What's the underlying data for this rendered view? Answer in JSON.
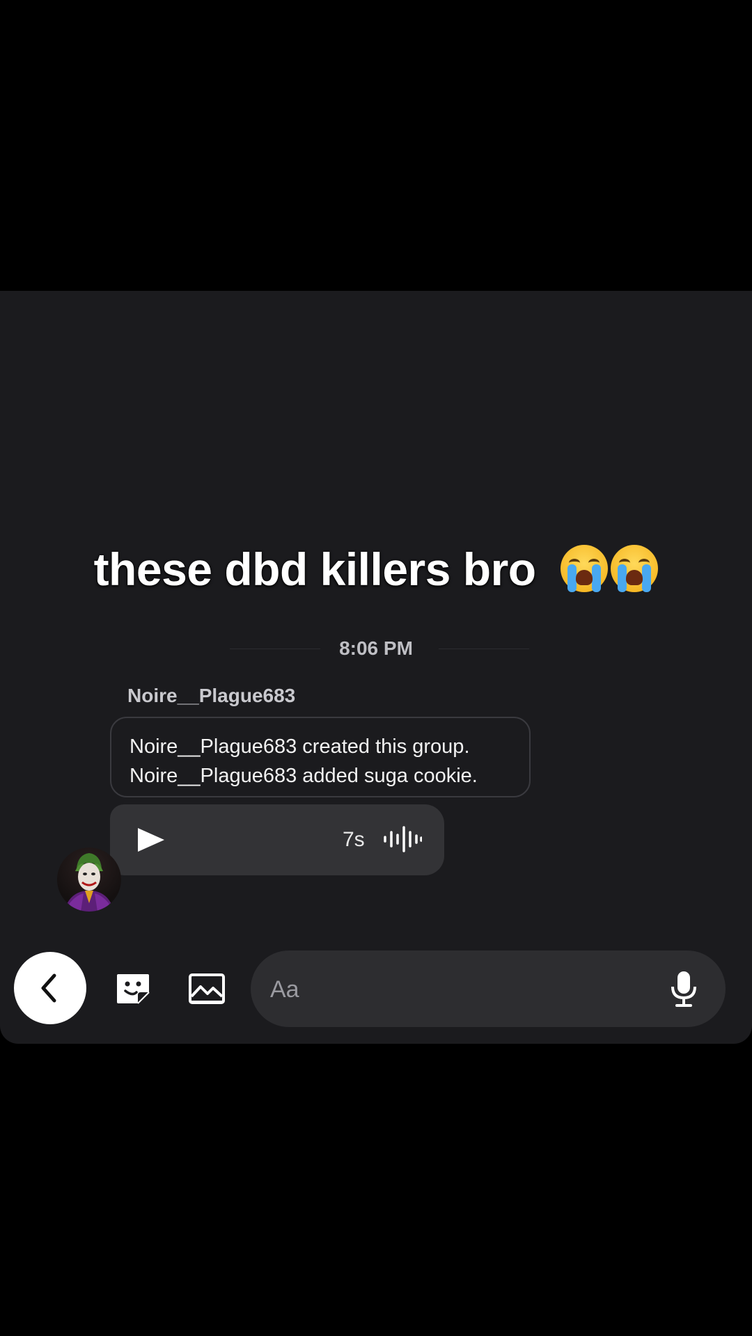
{
  "overlay_caption": {
    "text": "these dbd killers bro",
    "emojis": [
      "loudly-crying-face",
      "loudly-crying-face"
    ]
  },
  "chat": {
    "timestamp": "8:06 PM",
    "sender": "Noire__Plague683",
    "system_messages": [
      "Noire__Plague683 created this group.",
      "Noire__Plague683 added suga cookie."
    ],
    "voice_message": {
      "duration": "7s",
      "play_icon": "play-icon",
      "waveform_icon": "waveform-icon"
    },
    "avatar_icon": "joker-avatar"
  },
  "composer": {
    "placeholder": "Aa",
    "value": "",
    "icons": [
      "back-chevron-icon",
      "sticker-icon",
      "image-icon",
      "microphone-icon"
    ]
  },
  "colors": {
    "background": "#000000",
    "chat_background": "#1b1b1e",
    "bubble": "#333336",
    "composer": "#2d2d30",
    "text": "#ffffff"
  }
}
